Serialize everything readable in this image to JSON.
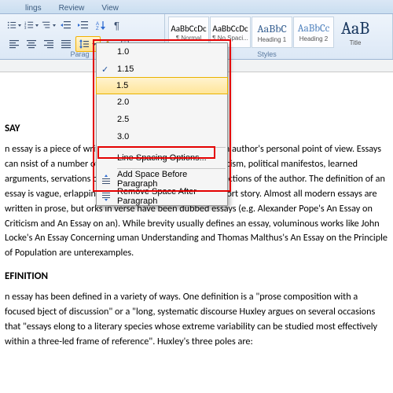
{
  "tabs": {
    "mailings": "lings",
    "review": "Review",
    "view": "View"
  },
  "ribbon": {
    "paragraph_label": "Parag",
    "styles_label": "Styles",
    "styles": [
      {
        "preview": "AaBbCcDc",
        "label": "¶ Normal"
      },
      {
        "preview": "AaBbCcDc",
        "label": "¶ No Spaci..."
      },
      {
        "preview": "AaBbC",
        "label": "Heading 1"
      },
      {
        "preview": "AaBbCc",
        "label": "Heading 2"
      },
      {
        "preview": "AaB",
        "label": "Title"
      }
    ]
  },
  "spacing_menu": {
    "items": [
      "1.0",
      "1.15",
      "1.5",
      "2.0",
      "2.5",
      "3.0"
    ],
    "checked_index": 1,
    "hover_index": 2,
    "options": "Line Spacing Options...",
    "add_before": "Add Space Before Paragraph",
    "remove_after": "Remove Space After Paragraph"
  },
  "doc": {
    "h1": "SAY",
    "p1": "n essay is a piece of writing which is often written from an author's personal point of view. Essays can nsist of a number of elements, including: literary criticism, political manifestos, learned arguments, servations of daily life, recollections, and reflections of the author. The definition of an essay is vague, erlapping with those of an article and a short story. Almost all modern essays are written in prose, but orks in verse have been dubbed essays (e.g. Alexander Pope's An Essay on Criticism and An Essay on an). While brevity usually defines an essay, voluminous works like John Locke's An Essay Concerning uman Understanding and Thomas Malthus's An Essay on the Principle of Population are unterexamples.",
    "h2": "EFINITION",
    "p2": "n essay has been defined in a variety of ways. One definition is a \"prose composition with a focused bject of discussion\" or a \"long, systematic discourse Huxley argues on several occasions that \"essays elong to a literary species whose extreme variability can be studied most effectively within a three-led frame of reference\". Huxley's three poles are:"
  }
}
